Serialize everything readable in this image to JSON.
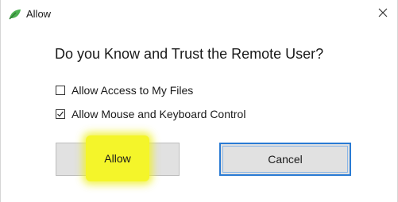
{
  "window": {
    "title": "Allow",
    "icon": "app-leaf-icon",
    "close_icon": "close-icon"
  },
  "prompt": {
    "question": "Do you Know and Trust the Remote User?"
  },
  "options": [
    {
      "label": "Allow Access to My Files",
      "checked": false
    },
    {
      "label": "Allow Mouse and Keyboard Control",
      "checked": true
    }
  ],
  "buttons": {
    "allow_label": "Allow",
    "cancel_label": "Cancel"
  },
  "colors": {
    "highlight": "#f4f52a",
    "focus_border": "#2a7bd4",
    "button_face": "#e1e1e1"
  }
}
